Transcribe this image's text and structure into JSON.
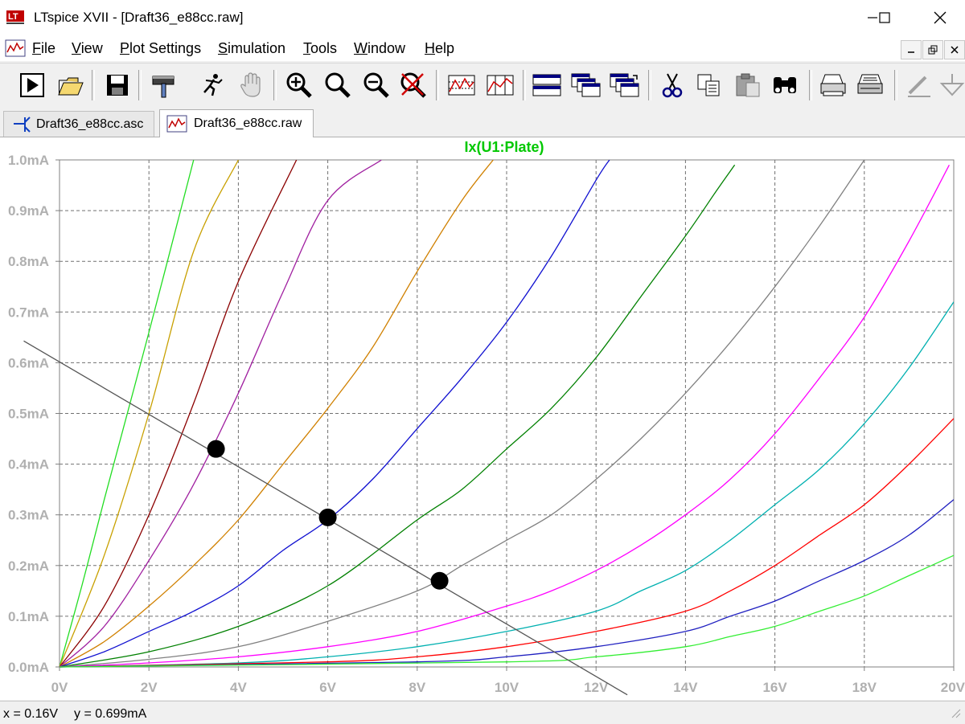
{
  "window": {
    "title": "LTspice XVII - [Draft36_e88cc.raw]",
    "controls": [
      "minimize",
      "maximize",
      "close"
    ]
  },
  "menu": [
    {
      "label": "File",
      "u": "F",
      "rest": "ile"
    },
    {
      "label": "View",
      "u": "V",
      "rest": "iew"
    },
    {
      "label": "Plot Settings",
      "u": "P",
      "rest": "lot Settings"
    },
    {
      "label": "Simulation",
      "u": "S",
      "rest": "imulation"
    },
    {
      "label": "Tools",
      "u": "T",
      "rest": "ools"
    },
    {
      "label": "Window",
      "u": "W",
      "rest": "indow"
    },
    {
      "label": "Help",
      "u": "H",
      "rest": "elp"
    }
  ],
  "toolbar": {
    "buttons": [
      "run-icon",
      "open-icon",
      "save-icon",
      "control-panel-icon",
      "halt-icon",
      "pan-icon",
      "zoom-in-icon",
      "zoom-area-icon",
      "zoom-out-icon",
      "zoom-fit-icon",
      "autorange-icon",
      "cursor-icon",
      "tile-horizontal-icon",
      "cascade-icon",
      "tile-vertical-icon",
      "cut-icon",
      "copy-icon",
      "paste-icon",
      "find-icon",
      "print-preview-icon",
      "print-icon",
      "wire-icon",
      "ground-icon"
    ]
  },
  "tabs": [
    {
      "label": "Draft36_e88cc.asc",
      "active": false
    },
    {
      "label": "Draft36_e88cc.raw",
      "active": true
    }
  ],
  "plot": {
    "trace_label": "Ix(U1:Plate)",
    "trace_label_color": "#00c800"
  },
  "status": {
    "x_readout": "x = 0.16V",
    "y_readout": "y = 0.699mA"
  },
  "chart_data": {
    "type": "line",
    "title": "Ix(U1:Plate)",
    "xlabel": "",
    "ylabel": "",
    "xlim": [
      0,
      20
    ],
    "ylim": [
      0,
      1.0
    ],
    "x_ticks": [
      "0V",
      "2V",
      "4V",
      "6V",
      "8V",
      "10V",
      "12V",
      "14V",
      "16V",
      "18V",
      "20V"
    ],
    "y_ticks": [
      "0.0mA",
      "0.1mA",
      "0.2mA",
      "0.3mA",
      "0.4mA",
      "0.5mA",
      "0.6mA",
      "0.7mA",
      "0.8mA",
      "0.9mA",
      "1.0mA"
    ],
    "grid": true,
    "series": [
      {
        "color": "#22dd22",
        "points": [
          [
            0,
            0
          ],
          [
            0.5,
            0.16
          ],
          [
            1,
            0.33
          ],
          [
            2,
            0.66
          ],
          [
            3.0,
            1.0
          ]
        ]
      },
      {
        "color": "#c8a000",
        "points": [
          [
            0,
            0
          ],
          [
            1,
            0.22
          ],
          [
            2,
            0.5
          ],
          [
            3,
            0.82
          ],
          [
            4,
            1.0
          ]
        ]
      },
      {
        "color": "#8b0000",
        "points": [
          [
            0,
            0
          ],
          [
            1,
            0.12
          ],
          [
            2,
            0.3
          ],
          [
            3,
            0.52
          ],
          [
            4,
            0.76
          ],
          [
            5.3,
            1.0
          ]
        ]
      },
      {
        "color": "#a020a0",
        "points": [
          [
            0,
            0
          ],
          [
            1,
            0.08
          ],
          [
            2,
            0.21
          ],
          [
            3,
            0.36
          ],
          [
            4,
            0.54
          ],
          [
            5,
            0.74
          ],
          [
            6,
            0.92
          ],
          [
            7.2,
            1.0
          ]
        ]
      },
      {
        "color": "#d08000",
        "points": [
          [
            0,
            0
          ],
          [
            1,
            0.05
          ],
          [
            2,
            0.12
          ],
          [
            3,
            0.2
          ],
          [
            4,
            0.29
          ],
          [
            5,
            0.4
          ],
          [
            6,
            0.51
          ],
          [
            7,
            0.63
          ],
          [
            8,
            0.78
          ],
          [
            9,
            0.92
          ],
          [
            9.7,
            1.0
          ]
        ]
      },
      {
        "color": "#1010d0",
        "points": [
          [
            0,
            0
          ],
          [
            1,
            0.03
          ],
          [
            2,
            0.07
          ],
          [
            3,
            0.11
          ],
          [
            4,
            0.16
          ],
          [
            5,
            0.23
          ],
          [
            6,
            0.29
          ],
          [
            7,
            0.37
          ],
          [
            8,
            0.47
          ],
          [
            9,
            0.57
          ],
          [
            10,
            0.68
          ],
          [
            11,
            0.81
          ],
          [
            12,
            0.96
          ],
          [
            12.3,
            1.0
          ]
        ]
      },
      {
        "color": "#008000",
        "points": [
          [
            0,
            0
          ],
          [
            2,
            0.03
          ],
          [
            4,
            0.08
          ],
          [
            6,
            0.16
          ],
          [
            8,
            0.29
          ],
          [
            9,
            0.35
          ],
          [
            10,
            0.43
          ],
          [
            11,
            0.51
          ],
          [
            12,
            0.61
          ],
          [
            13,
            0.73
          ],
          [
            14,
            0.85
          ],
          [
            14.7,
            0.94
          ],
          [
            15.1,
            0.99
          ]
        ]
      },
      {
        "color": "#808080",
        "points": [
          [
            0,
            0
          ],
          [
            2,
            0.015
          ],
          [
            4,
            0.04
          ],
          [
            6,
            0.09
          ],
          [
            8,
            0.15
          ],
          [
            9,
            0.2
          ],
          [
            10,
            0.25
          ],
          [
            11,
            0.3
          ],
          [
            12,
            0.37
          ],
          [
            13,
            0.45
          ],
          [
            14,
            0.54
          ],
          [
            15,
            0.64
          ],
          [
            16,
            0.75
          ],
          [
            17,
            0.87
          ],
          [
            18,
            1.0
          ]
        ]
      },
      {
        "color": "#ff00ff",
        "points": [
          [
            0,
            0
          ],
          [
            2,
            0.008
          ],
          [
            4,
            0.02
          ],
          [
            6,
            0.04
          ],
          [
            8,
            0.07
          ],
          [
            10,
            0.12
          ],
          [
            11,
            0.15
          ],
          [
            12,
            0.19
          ],
          [
            13,
            0.24
          ],
          [
            14,
            0.3
          ],
          [
            15,
            0.37
          ],
          [
            16,
            0.46
          ],
          [
            17,
            0.57
          ],
          [
            18,
            0.69
          ],
          [
            19,
            0.84
          ],
          [
            19.9,
            0.99
          ]
        ]
      },
      {
        "color": "#00b0b0",
        "points": [
          [
            0,
            0
          ],
          [
            4,
            0.008
          ],
          [
            6,
            0.02
          ],
          [
            8,
            0.04
          ],
          [
            10,
            0.07
          ],
          [
            12,
            0.11
          ],
          [
            13,
            0.15
          ],
          [
            14,
            0.19
          ],
          [
            15,
            0.25
          ],
          [
            16,
            0.32
          ],
          [
            17,
            0.39
          ],
          [
            18,
            0.48
          ],
          [
            19,
            0.59
          ],
          [
            20,
            0.72
          ]
        ]
      },
      {
        "color": "#ff0000",
        "points": [
          [
            0,
            0
          ],
          [
            6,
            0.01
          ],
          [
            8,
            0.02
          ],
          [
            10,
            0.04
          ],
          [
            12,
            0.07
          ],
          [
            14,
            0.11
          ],
          [
            15,
            0.15
          ],
          [
            16,
            0.2
          ],
          [
            17,
            0.26
          ],
          [
            18,
            0.32
          ],
          [
            19,
            0.4
          ],
          [
            20,
            0.49
          ]
        ]
      },
      {
        "color": "#2020c0",
        "points": [
          [
            0,
            0
          ],
          [
            8,
            0.01
          ],
          [
            10,
            0.02
          ],
          [
            12,
            0.04
          ],
          [
            14,
            0.07
          ],
          [
            15,
            0.1
          ],
          [
            16,
            0.13
          ],
          [
            17,
            0.17
          ],
          [
            18,
            0.21
          ],
          [
            19,
            0.26
          ],
          [
            20,
            0.33
          ]
        ]
      },
      {
        "color": "#33ee33",
        "points": [
          [
            0,
            0
          ],
          [
            10,
            0.01
          ],
          [
            12,
            0.02
          ],
          [
            14,
            0.04
          ],
          [
            15,
            0.06
          ],
          [
            16,
            0.08
          ],
          [
            17,
            0.11
          ],
          [
            18,
            0.14
          ],
          [
            19,
            0.18
          ],
          [
            20,
            0.22
          ]
        ]
      }
    ],
    "load_line": {
      "color": "#555555",
      "points": [
        [
          -0.8,
          0.643
        ],
        [
          12.7,
          -0.055
        ]
      ]
    },
    "markers": [
      [
        3.5,
        0.43
      ],
      [
        6.0,
        0.295
      ],
      [
        8.5,
        0.17
      ]
    ]
  }
}
